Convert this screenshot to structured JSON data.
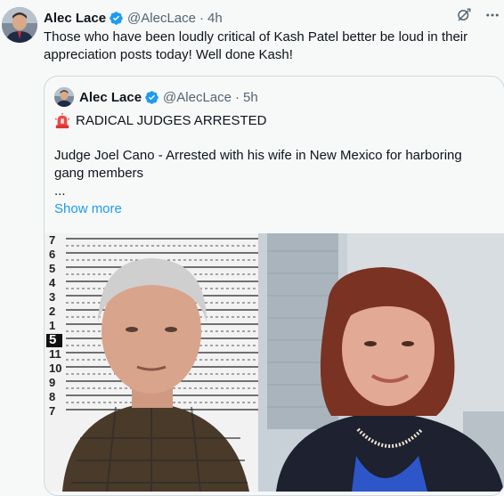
{
  "tweet": {
    "author_name": "Alec Lace",
    "handle": "@AlecLace",
    "separator": "·",
    "time": "4h",
    "text": "Those who have been loudly critical of Kash Patel better be loud in their appreciation posts today!  Well done Kash!"
  },
  "quoted": {
    "author_name": "Alec Lace",
    "handle": "@AlecLace",
    "separator": "·",
    "time": "5h",
    "headline": "RADICAL JUDGES ARRESTED",
    "body": "Judge Joel Cano - Arrested with his wife in New Mexico for harboring gang members",
    "ellipsis": "...",
    "show_more": "Show more",
    "height_chart_labels": [
      "7",
      "6",
      "5",
      "4",
      "3",
      "2",
      "1",
      "5",
      "11",
      "10",
      "9",
      "8",
      "7"
    ]
  },
  "icons": {
    "verified": "verified-badge-icon",
    "grok": "grok-icon",
    "more": "more-icon",
    "siren": "siren-emoji-icon"
  },
  "colors": {
    "verified_blue": "#1d9bf0",
    "link_blue": "#1d9bf0",
    "text": "#0f1419",
    "muted": "#536471"
  }
}
